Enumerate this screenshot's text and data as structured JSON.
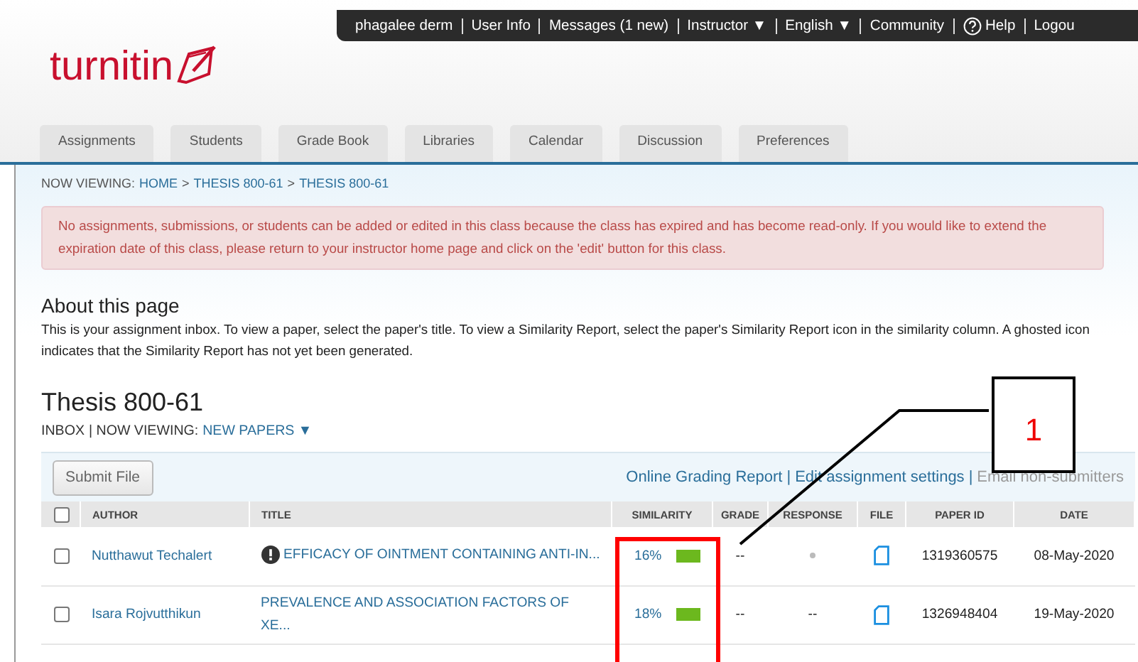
{
  "top_bar": {
    "items": [
      {
        "label": "phagalee derm",
        "kind": "text"
      },
      {
        "label": "User Info",
        "kind": "text"
      },
      {
        "label": "Messages (1 new)",
        "kind": "text"
      },
      {
        "label": "Instructor ▼",
        "kind": "text"
      },
      {
        "label": "English ▼",
        "kind": "text"
      },
      {
        "label": "Community",
        "kind": "text"
      },
      {
        "label": "Help",
        "kind": "help"
      },
      {
        "label": "Logou",
        "kind": "text"
      }
    ]
  },
  "logo": {
    "text": "turnitin"
  },
  "tabs": [
    {
      "label": "Assignments"
    },
    {
      "label": "Students"
    },
    {
      "label": "Grade Book"
    },
    {
      "label": "Libraries"
    },
    {
      "label": "Calendar"
    },
    {
      "label": "Discussion"
    },
    {
      "label": "Preferences"
    }
  ],
  "breadcrumb": {
    "prefix": "NOW VIEWING:",
    "links": [
      "HOME",
      "THESIS 800-61",
      "THESIS 800-61"
    ],
    "separator": ">"
  },
  "alert": "No assignments, submissions, or students can be added or edited in this class because the class has expired and has become read-only. If you would like to extend the expiration date of this class, please return to your instructor home page and click on the 'edit' button for this class.",
  "about": {
    "title": "About this page",
    "text": "This is your assignment inbox. To view a paper, select the paper's title. To view a Similarity Report, select the paper's Similarity Report icon in the similarity column. A ghosted icon indicates that the Similarity Report has not yet been generated."
  },
  "assignment": {
    "title": "Thesis 800-61",
    "inbox": "INBOX",
    "viewing_label": "| NOW VIEWING:",
    "viewing_value": "NEW PAPERS ▼"
  },
  "toolbar": {
    "button": "Submit File",
    "separator": "|",
    "links": [
      {
        "label": "Online Grading Report",
        "disabled": false
      },
      {
        "label": "Edit assignment settings",
        "disabled": false
      },
      {
        "label": "Email non-submitters",
        "disabled": true
      }
    ]
  },
  "table": {
    "select_all_checked": false,
    "columns": [
      "AUTHOR",
      "TITLE",
      "SIMILARITY",
      "GRADE",
      "RESPONSE",
      "FILE",
      "PAPER ID",
      "DATE"
    ],
    "rows": [
      {
        "checked": false,
        "author": "Nutthawut Techalert",
        "warning": true,
        "title": "EFFICACY OF OINTMENT CONTAINING ANTI-IN...",
        "similarity": "16%",
        "color": "#6cb81e",
        "grade": "--",
        "response_ghost": true,
        "paper_id": "1319360575",
        "date": "08-May-2020"
      },
      {
        "checked": false,
        "author": "Isara Rojvutthikun",
        "warning": false,
        "title": "PREVALENCE AND ASSOCIATION FACTORS OF XE...",
        "similarity": "18%",
        "color": "#6cb81e",
        "grade": "--",
        "response_ghost": false,
        "response": "--",
        "paper_id": "1326948404",
        "date": "19-May-2020"
      }
    ]
  },
  "annotation": {
    "label": "1"
  }
}
